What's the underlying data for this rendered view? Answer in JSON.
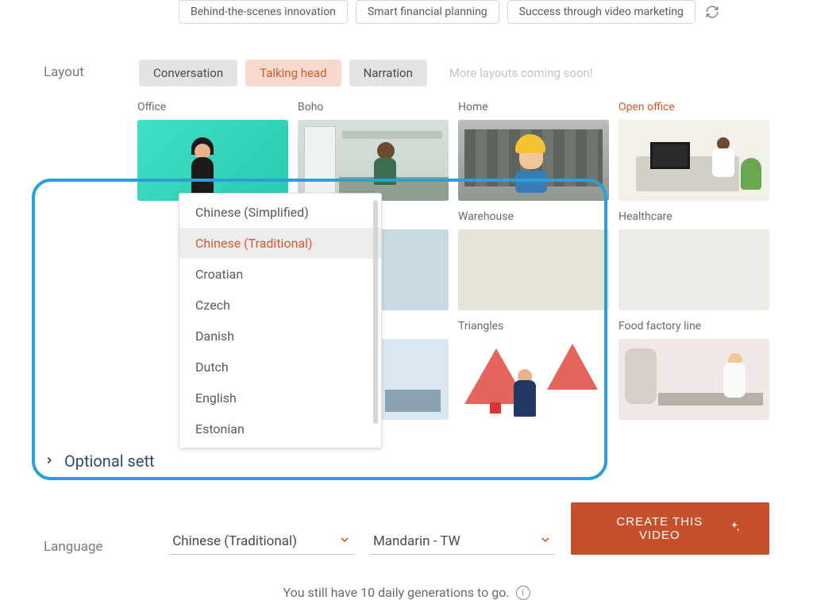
{
  "chips": [
    "Behind-the-scenes innovation",
    "Smart financial planning",
    "Success through video marketing"
  ],
  "layout": {
    "label": "Layout",
    "tabs": {
      "conversation": "Conversation",
      "talking_head": "Talking head",
      "narration": "Narration",
      "more": "More layouts coming soon!"
    }
  },
  "scenes": {
    "row1": [
      {
        "label": "Office",
        "class": "th-office"
      },
      {
        "label": "Boho",
        "class": "th-boho"
      },
      {
        "label": "Home",
        "class": "th-home"
      },
      {
        "label": "Open office",
        "class": "th-open",
        "highlight": true
      }
    ],
    "row2": [
      {
        "label": "",
        "class": "th-kitchen"
      },
      {
        "label": "Warehouse",
        "class": "th-warehouse"
      },
      {
        "label": "Healthcare",
        "class": "th-healthcare"
      }
    ],
    "row3": [
      {
        "label": "",
        "class": "th-airport"
      },
      {
        "label": "Triangles",
        "class": "th-triangles"
      },
      {
        "label": "Food factory line",
        "class": "th-factory"
      }
    ]
  },
  "optional_settings_label": "Optional sett",
  "language": {
    "label": "Language",
    "selected": "Chinese (Traditional)",
    "voice_selected": "Mandarin - TW",
    "options": [
      "Chinese (Simplified)",
      "Chinese (Traditional)",
      "Croatian",
      "Czech",
      "Danish",
      "Dutch",
      "English",
      "Estonian"
    ]
  },
  "cta_label": "CREATE THIS VIDEO",
  "footer_note": "You still have 10 daily generations to go."
}
